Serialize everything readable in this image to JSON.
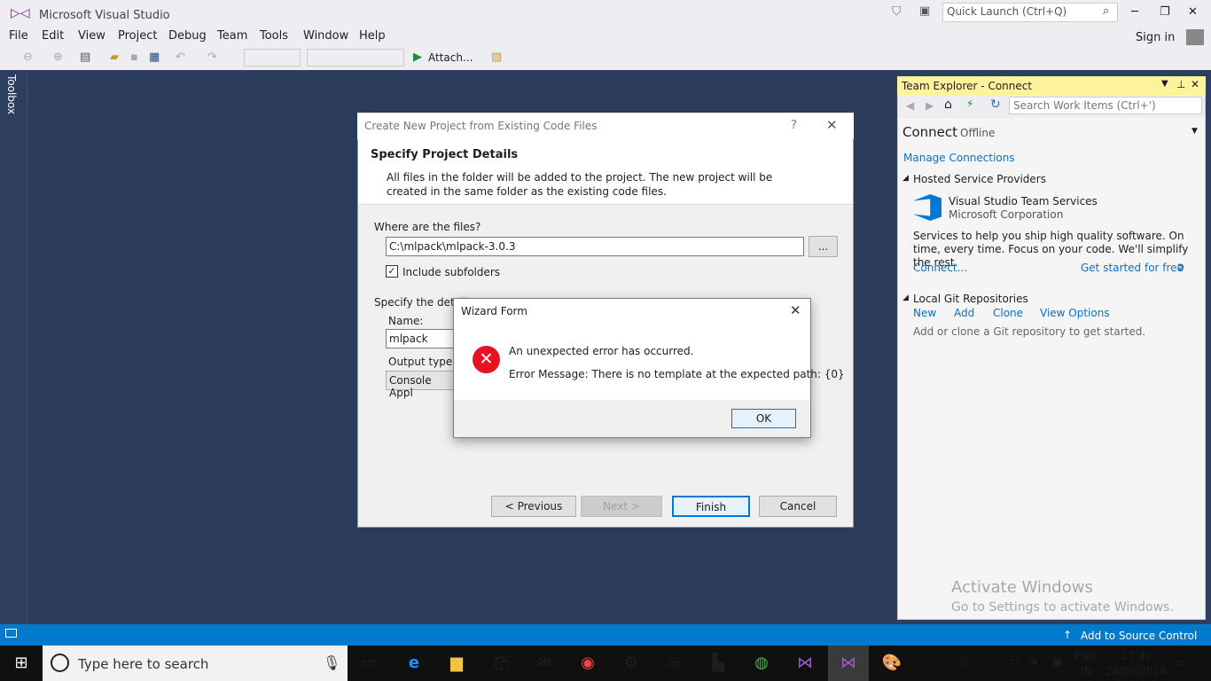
{
  "app": {
    "title": "Microsoft Visual Studio",
    "quick_launch_placeholder": "Quick Launch (Ctrl+Q)",
    "sign_in": "Sign in"
  },
  "menu": [
    "File",
    "Edit",
    "View",
    "Project",
    "Debug",
    "Team",
    "Tools",
    "Window",
    "Help"
  ],
  "toolbar": {
    "attach_label": "Attach..."
  },
  "toolbox": {
    "label": "Toolbox"
  },
  "wizard": {
    "title": "Create New Project from Existing Code Files",
    "help": "?",
    "heading": "Specify Project Details",
    "description": "All files in the folder will be added to the project.  The new project will be created in the same folder as the existing code files.",
    "files_label": "Where are the files?",
    "files_value": "C:\\mlpack\\mlpack-3.0.3",
    "browse": "...",
    "include_subfolders": "Include subfolders",
    "details_label": "Specify the detail",
    "name_label": "Name:",
    "name_value": "mlpack",
    "output_label": "Output type:",
    "output_value": "Console Appl",
    "btn_previous": "< Previous",
    "btn_next": "Next >",
    "btn_finish": "Finish",
    "btn_cancel": "Cancel"
  },
  "msgbox": {
    "title": "Wizard Form",
    "line1": "An unexpected error has occurred.",
    "line2": "Error Message: There is no template at the expected path: {0}",
    "ok": "OK"
  },
  "team_explorer": {
    "title": "Team Explorer - Connect",
    "search_placeholder": "Search Work Items (Ctrl+')",
    "connect": "Connect",
    "offline": "Offline",
    "manage": "Manage Connections",
    "hosted_header": "Hosted Service Providers",
    "vsts_name": "Visual Studio Team Services",
    "vsts_company": "Microsoft Corporation",
    "vsts_desc": "Services to help you ship high quality software. On time, every time. Focus on your code. We'll simplify the rest.",
    "connect_link": "Connect...",
    "get_started": "Get started for free",
    "local_header": "Local Git Repositories",
    "local_links": [
      "New",
      "Add",
      "Clone",
      "View Options"
    ],
    "local_hint": "Add or clone a Git repository to get started.",
    "activate_title": "Activate Windows",
    "activate_sub": "Go to Settings to activate Windows."
  },
  "statusbar": {
    "source_control": "Add to Source Control"
  },
  "taskbar": {
    "search_placeholder": "Type here to search",
    "lang": "ENG",
    "region": "IN",
    "time": "17:42",
    "date": "24/09/2018"
  },
  "colors": {
    "accent": "#007acc",
    "error_red": "#e81123",
    "te_title": "#fff29d",
    "link": "#0e70c0"
  }
}
